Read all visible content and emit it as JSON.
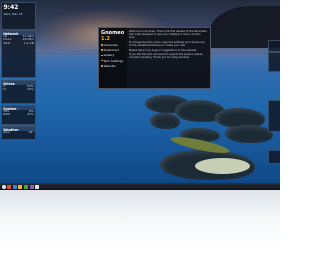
{
  "left_widgets": {
    "clock": {
      "time": "9:42",
      "date": "Wed, Mar 18"
    },
    "network": {
      "title": "Network",
      "rows": [
        [
          "Up",
          "12 kB/s"
        ],
        [
          "Down",
          "48 kB/s"
        ],
        [
          "Total",
          "1.2 GB"
        ]
      ]
    },
    "drives": {
      "title": "Drives",
      "rows": [
        [
          "C:",
          "64%"
        ],
        [
          "D:",
          "22%"
        ]
      ]
    },
    "system": {
      "title": "System",
      "rows": [
        [
          "CPU",
          "8%"
        ],
        [
          "RAM",
          "41%"
        ]
      ]
    },
    "weather": {
      "title": "Weather",
      "rows": [
        [
          "Now",
          "18°"
        ]
      ]
    }
  },
  "gnomeo": {
    "app_name": "Gnomeo",
    "version": "1.2",
    "menu": [
      "Overview",
      "Download",
      "Gallery",
      "Skin Settings",
      "Website"
    ],
    "paragraphs": [
      "Welcome to Gnomeo. This is the first release of the Rainmeter skin suite designed to give your desktop a clean, modern look.",
      "To change the skin colors, open the settings and choose one of the predefined themes or create your own.",
      "Please report any bugs or suggestions on the website.",
      "If you like this skin and want to support the project, please consider donating. Thank you for using Gnomeo."
    ]
  },
  "taskbar": {
    "icon_colors": [
      "#e84a3c",
      "#3b86d6",
      "#f2b233",
      "#47a447",
      "#9b59b6",
      "#e0e0e0"
    ]
  }
}
